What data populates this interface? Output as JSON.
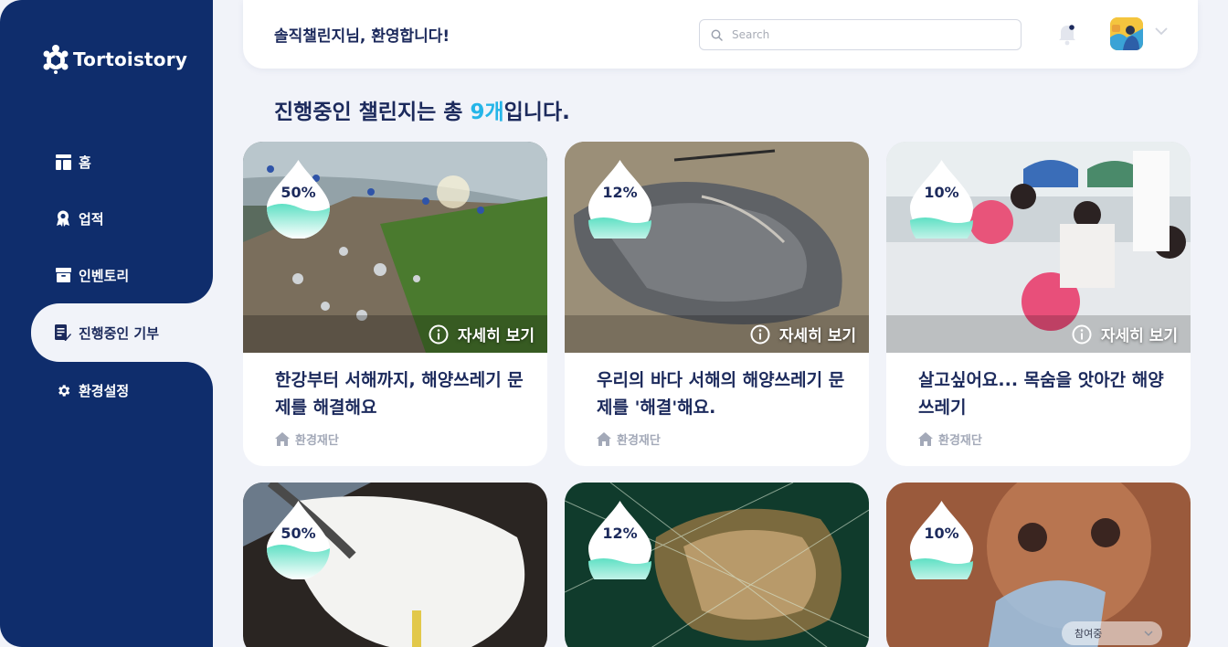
{
  "brand": {
    "name": "Tortoistory"
  },
  "sidebar": {
    "items": [
      {
        "label": "홈",
        "icon": "home-icon",
        "active": false
      },
      {
        "label": "업적",
        "icon": "medal-icon",
        "active": false
      },
      {
        "label": "인벤토리",
        "icon": "archive-icon",
        "active": false
      },
      {
        "label": "진행중인 기부",
        "icon": "donation-list-icon",
        "active": true
      },
      {
        "label": "환경설정",
        "icon": "gear-icon",
        "active": false
      }
    ]
  },
  "header": {
    "greeting": "솔직챌린지님, 환영합니다!",
    "search_placeholder": "Search"
  },
  "heading": {
    "prefix": "진행중인 챌린지는 총 ",
    "count": "9개",
    "suffix": "입니다."
  },
  "cards": [
    {
      "percent": "50%",
      "progress": 0.5,
      "title": "한강부터 서해까지, 해양쓰레기 문제를 해결해요",
      "org": "환경재단",
      "detail_label": "자세히 보기"
    },
    {
      "percent": "12%",
      "progress": 0.12,
      "title": "우리의 바다 서해의 해양쓰레기 문제를 '해결'해요.",
      "org": "환경재단",
      "detail_label": "자세히 보기"
    },
    {
      "percent": "10%",
      "progress": 0.1,
      "title": "살고싶어요... 목숨을 앗아간 해양 쓰레기",
      "org": "환경재단",
      "detail_label": "자세히 보기"
    },
    {
      "percent": "50%",
      "progress": 0.5
    },
    {
      "percent": "12%",
      "progress": 0.12
    },
    {
      "percent": "10%",
      "progress": 0.1
    }
  ],
  "status_select": {
    "value": "참여중"
  },
  "colors": {
    "sidebar": "#0f2d6c",
    "accent": "#25b5e8",
    "wave": "#5fe0c4",
    "text": "#1c2a5c"
  }
}
